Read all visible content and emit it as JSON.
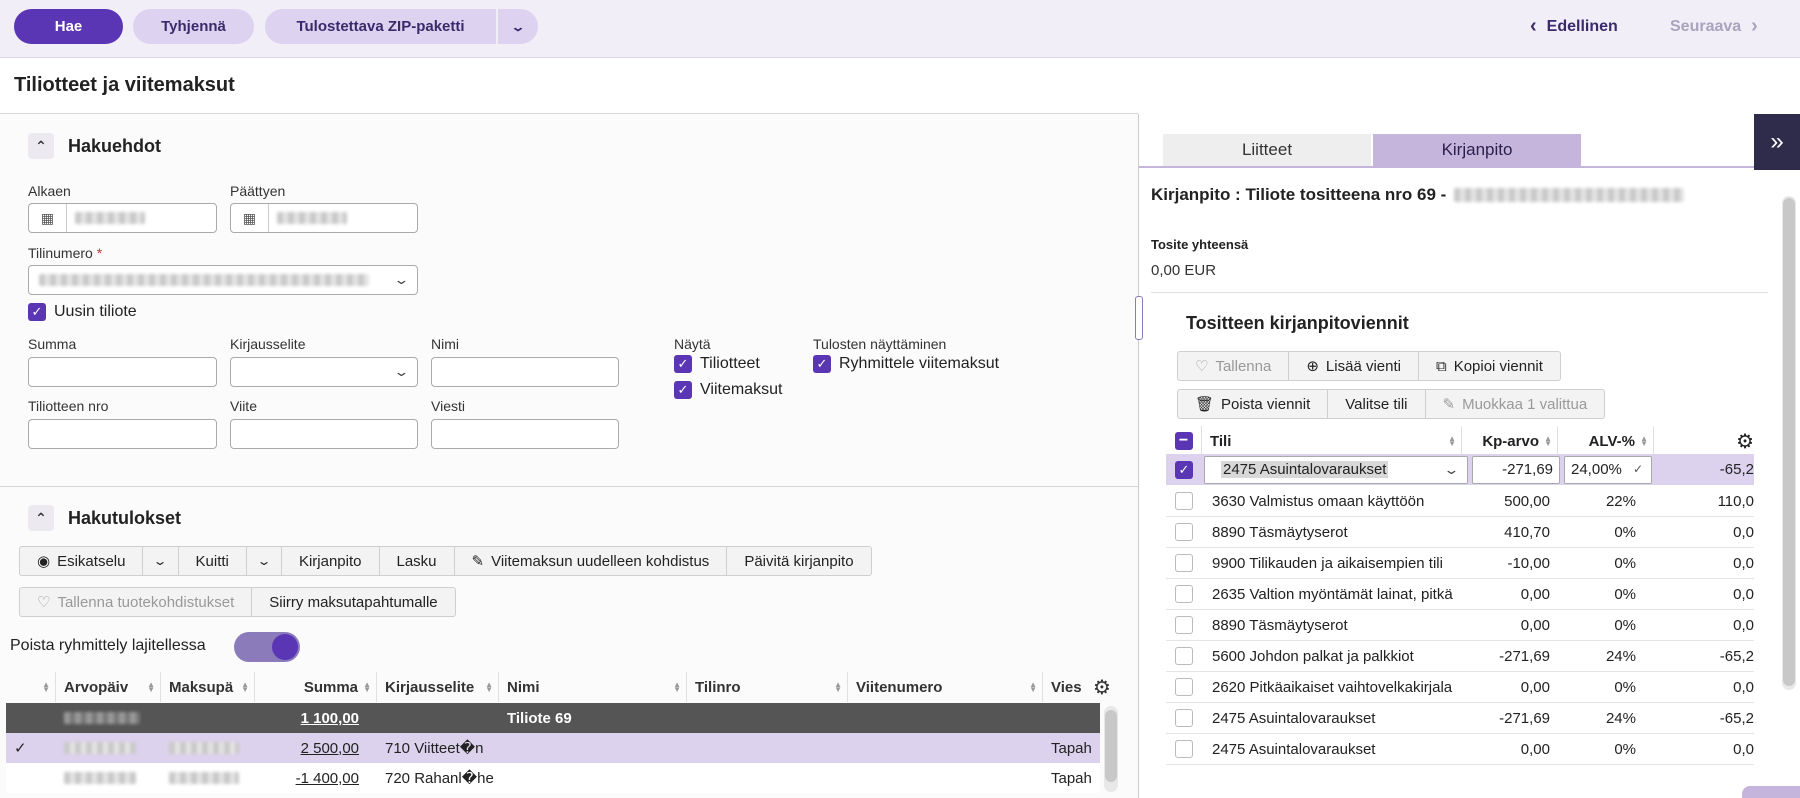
{
  "toolbar": {
    "search_label": "Hae",
    "clear_label": "Tyhjennä",
    "zip_label": "Tulostettava ZIP-paketti",
    "prev_label": "Edellinen",
    "next_label": "Seuraava"
  },
  "page": {
    "title": "Tiliotteet ja viitemaksut"
  },
  "criteria": {
    "heading": "Hakuehdot",
    "start_label": "Alkaen",
    "end_label": "Päättyen",
    "account_label": "Tilinumero",
    "required_mark": "*",
    "new_statement_label": "Uusin tiliote",
    "sum_label": "Summa",
    "entry_label": "Kirjausselite",
    "name_label": "Nimi",
    "statement_no_label": "Tiliotteen nro",
    "reference_label": "Viite",
    "message_label": "Viesti",
    "show_label": "Näytä",
    "show_statements": "Tiliotteet",
    "show_refpayments": "Viitemaksut",
    "display_label": "Tulosten näyttäminen",
    "group_refpayments": "Ryhmittele viitemaksut"
  },
  "results": {
    "heading": "Hakutulokset",
    "buttons1": [
      "Esikatselu",
      "Kuitti",
      "Kirjanpito",
      "Lasku",
      "Viitemaksun uudelleen kohdistus",
      "Päivitä kirjanpito"
    ],
    "buttons2": [
      "Tallenna tuotekohdistukset",
      "Siirry maksutapahtumalle"
    ],
    "ungroup_label": "Poista ryhmittely lajitellessa",
    "columns": [
      "Arvopäiv",
      "Maksupä",
      "Summa",
      "Kirjausselite",
      "Nimi",
      "Tilinro",
      "Viitenumero",
      "Vies"
    ],
    "group_row": {
      "sum": "1 100,00",
      "label": "Tiliote 69"
    },
    "rows": [
      {
        "sum": "2 500,00",
        "entry": "710 Viitteet�n",
        "message": "Tapah"
      },
      {
        "sum": "-1 400,00",
        "entry": "720 Rahanl�he",
        "message": "Tapah"
      }
    ]
  },
  "right": {
    "tab_attachments": "Liitteet",
    "tab_bookkeeping": "Kirjanpito",
    "heading": "Kirjanpito : Tiliote tositteena nro 69 -",
    "total_label": "Tosite yhteensä",
    "total_value": "0,00 EUR",
    "entries_heading": "Tositteen kirjanpitoviennit",
    "btn_save": "Tallenna",
    "btn_add": "Lisää vienti",
    "btn_copy": "Kopioi viennit",
    "btn_delete": "Poista viennit",
    "btn_select": "Valitse tili",
    "btn_edit": "Muokkaa 1 valittua",
    "col_account": "Tili",
    "col_amount": "Kp-arvo",
    "col_vat": "ALV-%",
    "selected_row": {
      "account": "2475 Asuintalovaraukset",
      "amount": "-271,69",
      "vat": "24,00%",
      "last": "-65,2"
    },
    "rows": [
      {
        "account": "3630 Valmistus omaan käyttöön",
        "amount": "500,00",
        "vat": "22%",
        "last": "110,0"
      },
      {
        "account": "8890 Täsmäytyserot",
        "amount": "410,70",
        "vat": "0%",
        "last": "0,0"
      },
      {
        "account": "9900 Tilikauden ja aikaisempien tili",
        "amount": "-10,00",
        "vat": "0%",
        "last": "0,0"
      },
      {
        "account": "2635 Valtion myöntämät lainat, pitkä",
        "amount": "0,00",
        "vat": "0%",
        "last": "0,0"
      },
      {
        "account": "8890 Täsmäytyserot",
        "amount": "0,00",
        "vat": "0%",
        "last": "0,0"
      },
      {
        "account": "5600 Johdon palkat ja palkkiot",
        "amount": "-271,69",
        "vat": "24%",
        "last": "-65,2"
      },
      {
        "account": "2620 Pitkäaikaiset vaihtovelkakirjala",
        "amount": "0,00",
        "vat": "0%",
        "last": "0,0"
      },
      {
        "account": "2475 Asuintalovaraukset",
        "amount": "-271,69",
        "vat": "24%",
        "last": "-65,2"
      },
      {
        "account": "2475 Asuintalovaraukset",
        "amount": "0,00",
        "vat": "0%",
        "last": "0,0"
      }
    ]
  },
  "colors": {
    "primary": "#5a36b4",
    "secondary": "#ddd3f0",
    "selected_row": "#dcd2ee"
  }
}
